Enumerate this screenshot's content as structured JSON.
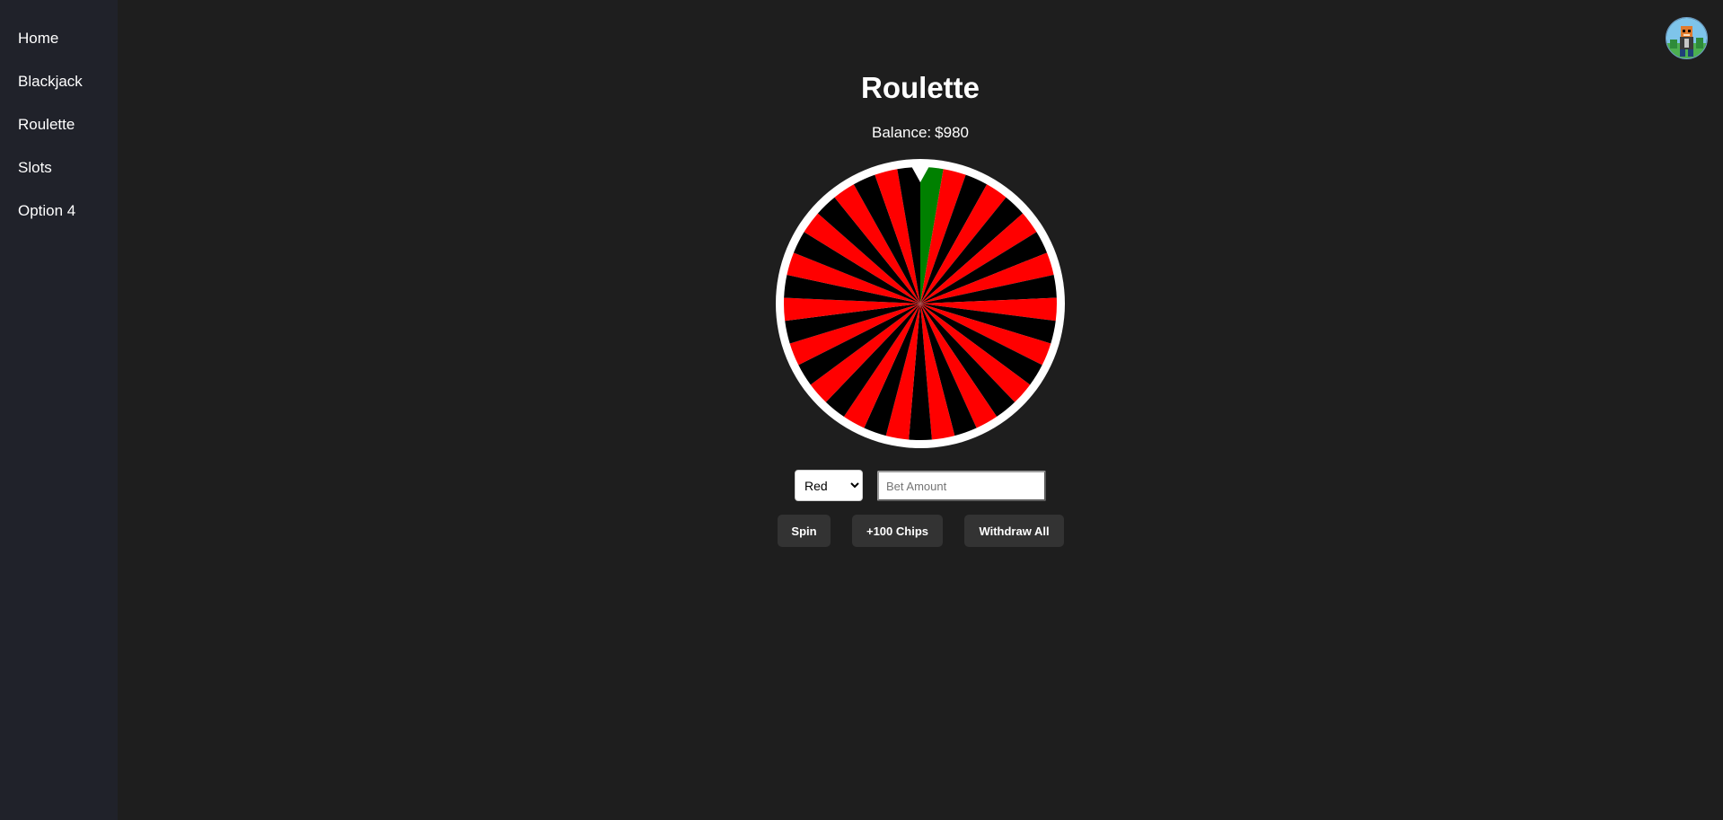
{
  "sidebar": {
    "items": [
      {
        "label": "Home"
      },
      {
        "label": "Blackjack"
      },
      {
        "label": "Roulette"
      },
      {
        "label": "Slots"
      },
      {
        "label": "Option 4"
      }
    ]
  },
  "header": {
    "avatar_icon": "user-avatar-icon"
  },
  "main": {
    "title": "Roulette",
    "balance_label": "Balance:",
    "balance_value": "$980"
  },
  "wheel": {
    "pocket_count": 37,
    "green_pocket_index": 0,
    "colors": {
      "red": "#ff0000",
      "black": "#000000",
      "green": "#008000",
      "rim": "#ffffff"
    }
  },
  "controls": {
    "bet_select": {
      "selected": "Red",
      "options": [
        "Red"
      ]
    },
    "bet_amount": {
      "value": "",
      "placeholder": "Bet Amount"
    },
    "spin_label": "Spin",
    "add_chips_label": "+100 Chips",
    "withdraw_label": "Withdraw All"
  },
  "theme": {
    "page_background": "#1e1e1e",
    "sidebar_background": "#20222a",
    "button_background": "#333333"
  }
}
